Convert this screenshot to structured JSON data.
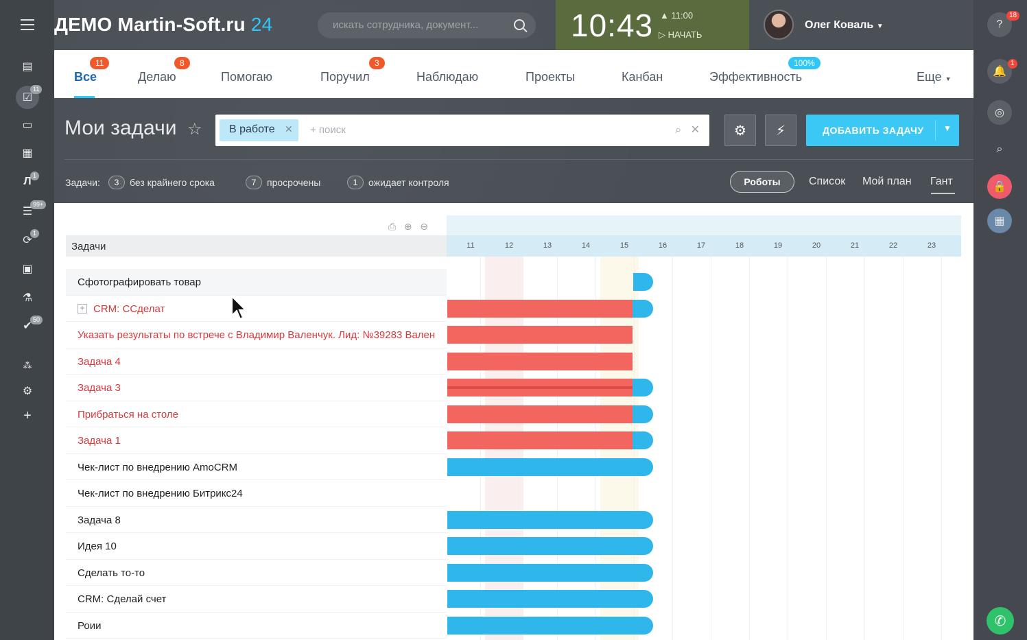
{
  "header": {
    "logo_text": "ДЕМО Martin-Soft.ru",
    "logo_num": "24",
    "search_placeholder": "искать сотрудника, документ...",
    "clock": "10:43",
    "clock_alarm": "11:00",
    "clock_start": "НАЧАТЬ",
    "user_name": "Олег Коваль"
  },
  "tabs": [
    {
      "label": "Все",
      "badge": "11"
    },
    {
      "label": "Делаю",
      "badge": "8"
    },
    {
      "label": "Помогаю",
      "badge": ""
    },
    {
      "label": "Поручил",
      "badge": "3"
    },
    {
      "label": "Наблюдаю",
      "badge": ""
    },
    {
      "label": "Проекты",
      "badge": ""
    },
    {
      "label": "Канбан",
      "badge": ""
    },
    {
      "label": "Эффективность",
      "badge": "100%"
    },
    {
      "label": "Еще",
      "badge": ""
    }
  ],
  "toolbar": {
    "title": "Мои задачи",
    "filter_chip": "В работе",
    "filter_placeholder": "+ поиск",
    "add_label": "ДОБАВИТЬ ЗАДАЧУ"
  },
  "counters": {
    "label": "Задачи:",
    "no_deadline_count": "3",
    "no_deadline_label": "без крайнего срока",
    "overdue_count": "7",
    "overdue_label": "просрочены",
    "control_count": "1",
    "control_label": "ожидает контроля"
  },
  "views": {
    "robots": "Роботы",
    "list": "Список",
    "plan": "Мой план",
    "gantt": "Гант"
  },
  "left_badges": {
    "tasks": "11",
    "l": "1",
    "filter": "99+",
    "sync": "1",
    "check": "50"
  },
  "right_badges": {
    "help": "18",
    "notify": "1"
  },
  "gantt": {
    "column_title": "Задачи",
    "days": [
      "11",
      "12",
      "13",
      "14",
      "15",
      "16",
      "17",
      "18",
      "19",
      "20",
      "21",
      "22",
      "23"
    ],
    "tasks": [
      {
        "name": "Сфотографировать товар",
        "overdue": false
      },
      {
        "name": "CRM: ССделат",
        "overdue": true
      },
      {
        "name": "Указать результаты по встрече с Владимир Валенчук. Лид: №39283 Вален",
        "overdue": true
      },
      {
        "name": "Задача 4",
        "overdue": true
      },
      {
        "name": "Задача 3",
        "overdue": true
      },
      {
        "name": "Прибраться на столе",
        "overdue": true
      },
      {
        "name": "Задача 1",
        "overdue": true
      },
      {
        "name": "Чек-лист по внедрению AmoCRM",
        "overdue": false
      },
      {
        "name": "Чек-лист по внедрению Битрикс24",
        "overdue": false
      },
      {
        "name": "Задача 8",
        "overdue": false
      },
      {
        "name": "Идея 10",
        "overdue": false
      },
      {
        "name": "Сделать то-то",
        "overdue": false
      },
      {
        "name": "CRM: Сделай счет",
        "overdue": false
      },
      {
        "name": "Роии",
        "overdue": false
      }
    ]
  },
  "colors": {
    "accent": "#2fc7f7",
    "overdue_bar": "#f2665f",
    "task_bar": "#2fb7eb",
    "clock_bg": "#5a6b3e"
  }
}
